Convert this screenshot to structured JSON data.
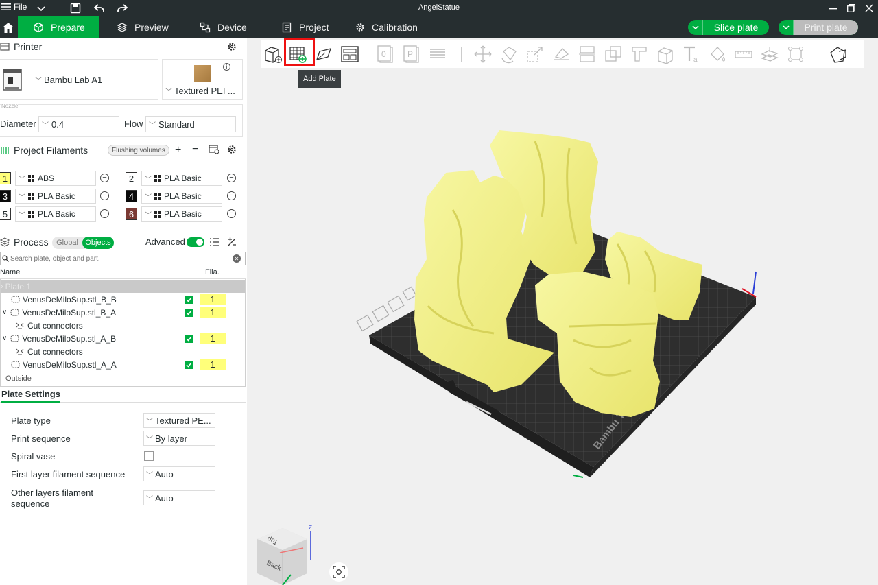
{
  "titlebar": {
    "file_label": "File",
    "title": "AngelStatue"
  },
  "nav": {
    "tabs": [
      {
        "label": "Prepare"
      },
      {
        "label": "Preview"
      },
      {
        "label": "Device"
      },
      {
        "label": "Project"
      },
      {
        "label": "Calibration"
      }
    ],
    "slice_label": "Slice plate",
    "print_label": "Print plate"
  },
  "printer": {
    "header": "Printer",
    "name": "Bambu Lab A1",
    "plate": "Textured PEI ...",
    "nozzle_label": "Nozzle",
    "diameter_label": "Diameter",
    "diameter_value": "0.4",
    "flow_label": "Flow",
    "flow_value": "Standard"
  },
  "filaments": {
    "header": "Project Filaments",
    "flushing_label": "Flushing volumes",
    "items": [
      {
        "num": "1",
        "name": "ABS",
        "color": "#ffff7a",
        "fg": "#262e30"
      },
      {
        "num": "2",
        "name": "PLA Basic",
        "color": "#ffffff",
        "fg": "#262e30"
      },
      {
        "num": "3",
        "name": "PLA Basic",
        "color": "#0a0a0a",
        "fg": "#ffffff"
      },
      {
        "num": "4",
        "name": "PLA Basic",
        "color": "#0a0a0a",
        "fg": "#ffffff"
      },
      {
        "num": "5",
        "name": "PLA Basic",
        "color": "#ffffff",
        "fg": "#262e30"
      },
      {
        "num": "6",
        "name": "PLA Basic",
        "color": "#7b3a34",
        "fg": "#ffffff"
      }
    ]
  },
  "process": {
    "header": "Process",
    "global_label": "Global",
    "objects_label": "Objects",
    "advanced_label": "Advanced",
    "search_placeholder": "Search plate, object and part.",
    "col_name": "Name",
    "col_fila": "Fila.",
    "rows": [
      {
        "label": "Plate 1",
        "type": "plate"
      },
      {
        "label": "VenusDeMiloSup.stl_B_B",
        "type": "object",
        "expand": false,
        "fila": "1"
      },
      {
        "label": "VenusDeMiloSup.stl_B_A",
        "type": "object",
        "expand": true,
        "fila": "1"
      },
      {
        "label": "Cut connectors",
        "type": "connector"
      },
      {
        "label": "VenusDeMiloSup.stl_A_B",
        "type": "object",
        "expand": true,
        "fila": "1"
      },
      {
        "label": "Cut connectors",
        "type": "connector"
      },
      {
        "label": "VenusDeMiloSup.stl_A_A",
        "type": "object",
        "expand": false,
        "fila": "1"
      },
      {
        "label": "Outside",
        "type": "outside"
      }
    ]
  },
  "plate_settings": {
    "tab_label": "Plate Settings",
    "rows": [
      {
        "label": "Plate type",
        "value": "Textured PE..."
      },
      {
        "label": "Print sequence",
        "value": "By layer"
      },
      {
        "label": "Spiral vase",
        "checkbox": true
      },
      {
        "label": "First layer filament sequence",
        "value": "Auto"
      },
      {
        "label": "Other layers filament sequence",
        "value": "Auto"
      }
    ]
  },
  "viewport": {
    "tooltip": "Add Plate",
    "bed_text": "Bambu Tex",
    "cube_top": "Top",
    "cube_back": "Back",
    "axis_z": "Z"
  },
  "colors": {
    "accent": "#00ae42",
    "dark": "#262e30",
    "model": "#f4f58e"
  }
}
